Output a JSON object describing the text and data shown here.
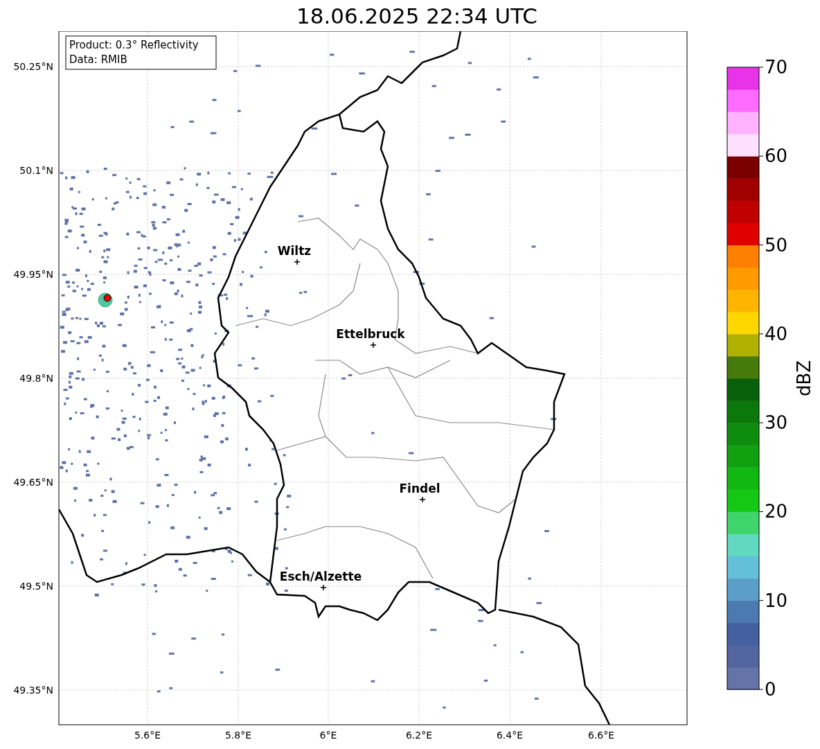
{
  "title": "18.06.2025 22:34 UTC",
  "map": {
    "info_box": [
      "Product: 0.3° Reflectivity",
      "Data: RMIB"
    ],
    "lat_ticks": [
      "50.25°N",
      "50.1°N",
      "49.95°N",
      "49.8°N",
      "49.65°N",
      "49.5°N",
      "49.35°N"
    ],
    "lon_ticks": [
      "5.6°E",
      "5.8°E",
      "6°E",
      "6.2°E",
      "6.4°E",
      "6.6°E"
    ],
    "cities": [
      {
        "name": "Wiltz"
      },
      {
        "name": "Ettelbruck"
      },
      {
        "name": "Findel"
      },
      {
        "name": "Esch/Alzette"
      }
    ]
  },
  "colorbar": {
    "label": "dBZ",
    "ticks": [
      "70",
      "60",
      "50",
      "40",
      "30",
      "20",
      "10",
      "0"
    ],
    "segments": [
      {
        "color": "#6474a8"
      },
      {
        "color": "#52659f"
      },
      {
        "color": "#4560a0"
      },
      {
        "color": "#4a7ab0"
      },
      {
        "color": "#5b9fc8"
      },
      {
        "color": "#64bfd8"
      },
      {
        "color": "#62d8c0"
      },
      {
        "color": "#3fd46c"
      },
      {
        "color": "#14c814"
      },
      {
        "color": "#12b812"
      },
      {
        "color": "#10a010"
      },
      {
        "color": "#0e8c0e"
      },
      {
        "color": "#0b780b"
      },
      {
        "color": "#08600a"
      },
      {
        "color": "#467a0a"
      },
      {
        "color": "#b0b000"
      },
      {
        "color": "#ffd700"
      },
      {
        "color": "#ffb400"
      },
      {
        "color": "#ff9a00"
      },
      {
        "color": "#ff7f00"
      },
      {
        "color": "#e00000"
      },
      {
        "color": "#c00000"
      },
      {
        "color": "#a00000"
      },
      {
        "color": "#7a0000"
      },
      {
        "color": "#ffe0ff"
      },
      {
        "color": "#ffb3ff"
      },
      {
        "color": "#ff6aff"
      },
      {
        "color": "#e933e9"
      }
    ]
  }
}
